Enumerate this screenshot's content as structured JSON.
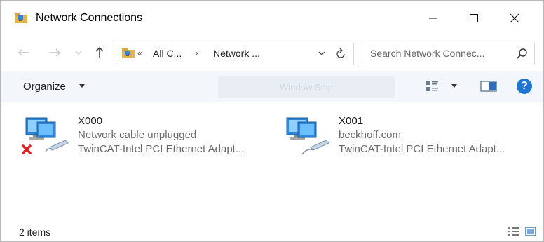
{
  "window": {
    "title": "Network Connections"
  },
  "navigation": {
    "breadcrumbs": [
      "All C...",
      "Network ..."
    ],
    "overflow_chevron": "«",
    "separator": "›"
  },
  "search": {
    "placeholder": "Search Network Connec..."
  },
  "toolbar": {
    "organize_label": "Organize",
    "ghost_label": "Window Snip"
  },
  "connections": [
    {
      "name": "X000",
      "status": "Network cable unplugged",
      "adapter": "TwinCAT-Intel PCI Ethernet Adapt...",
      "disconnected": true
    },
    {
      "name": "X001",
      "status": "beckhoff.com",
      "adapter": "TwinCAT-Intel PCI Ethernet Adapt...",
      "disconnected": false
    }
  ],
  "statusbar": {
    "count": "2 items"
  },
  "colors": {
    "accent": "#1f76d2",
    "error_x": "#e02020",
    "toolbar_bg": "#f3f6fa"
  }
}
